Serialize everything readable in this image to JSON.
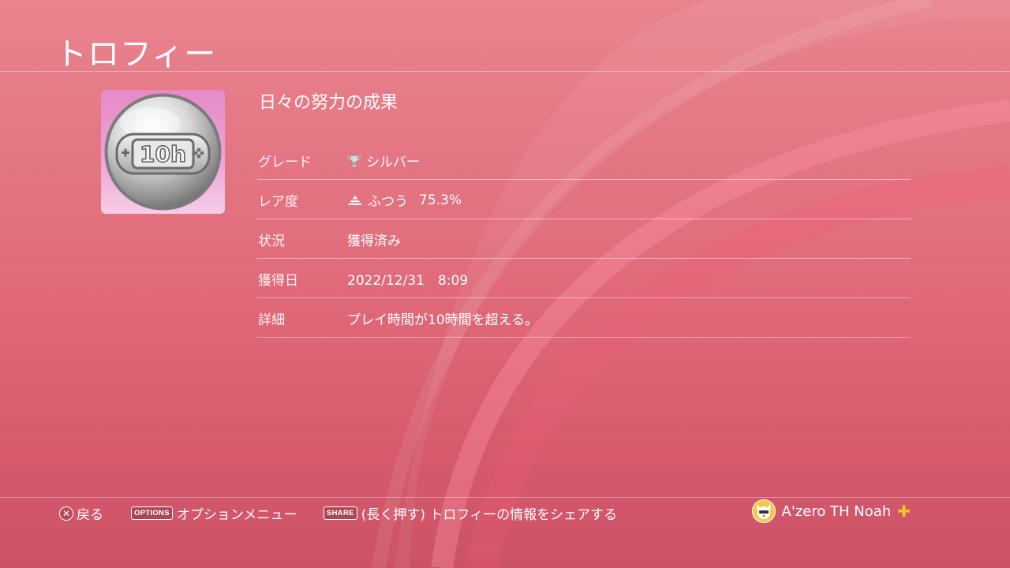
{
  "page": {
    "title": "トロフィー"
  },
  "trophy": {
    "name": "日々の努力の成果",
    "badge_text": "10h",
    "rows": [
      {
        "label": "グレード",
        "value": "シルバー",
        "icon": "silver-trophy-icon"
      },
      {
        "label": "レア度",
        "value": "ふつう",
        "percent": "75.3%",
        "icon": "rarity-common-icon"
      },
      {
        "label": "状況",
        "value": "獲得済み"
      },
      {
        "label": "獲得日",
        "value": "2022/12/31　8:09"
      },
      {
        "label": "詳細",
        "value": "プレイ時間が10時間を超える。"
      }
    ]
  },
  "footer": {
    "back": {
      "icon": "cross-button-icon",
      "label": "戻る"
    },
    "options": {
      "key": "OPTIONS",
      "label": "オプションメニュー"
    },
    "share": {
      "key": "SHARE",
      "label": "(長く押す) トロフィーの情報をシェアする"
    },
    "user": {
      "name": "A'zero TH Noah",
      "avatar": "avatar",
      "plus": "ps-plus-icon"
    }
  },
  "colors": {
    "background_top": "#e8848e",
    "background_bottom": "#cc5266",
    "plus_gold": "#f6c12a"
  }
}
